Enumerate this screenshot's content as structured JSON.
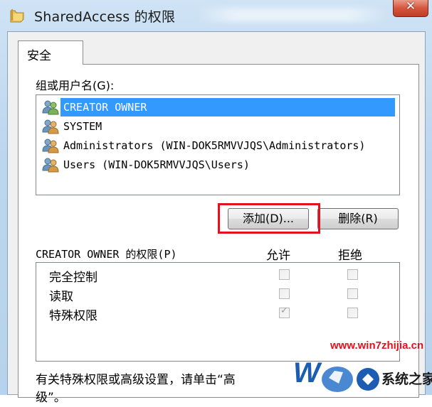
{
  "window": {
    "title": "SharedAccess 的权限",
    "close_label": "✕"
  },
  "tabs": [
    {
      "label": "安全",
      "selected": true
    }
  ],
  "security": {
    "groups_label": "组或用户名(G):",
    "users": [
      {
        "name": "CREATOR OWNER",
        "selected": true
      },
      {
        "name": "SYSTEM",
        "selected": false
      },
      {
        "name": "Administrators (WIN-DOK5RMVVJQS\\Administrators)",
        "selected": false
      },
      {
        "name": "Users (WIN-DOK5RMVVJQS\\Users)",
        "selected": false
      }
    ],
    "add_button": "添加(D)...",
    "remove_button": "删除(R)",
    "permissions_label": "CREATOR OWNER 的权限(P)",
    "allow_header": "允许",
    "deny_header": "拒绝",
    "permissions": [
      {
        "name": "完全控制",
        "allow": false,
        "deny": false
      },
      {
        "name": "读取",
        "allow": false,
        "deny": false
      },
      {
        "name": "特殊权限",
        "allow": true,
        "deny": false
      }
    ],
    "footer_line1": "有关特殊权限或高级设置，请单击“高",
    "footer_line2": "级”。"
  },
  "watermark": {
    "url": "www.win7zhijia.cn",
    "brand": "系统之家"
  },
  "colors": {
    "selection": "#3399ff",
    "highlight_box": "#e3101d",
    "close_button": "#c23c22"
  }
}
